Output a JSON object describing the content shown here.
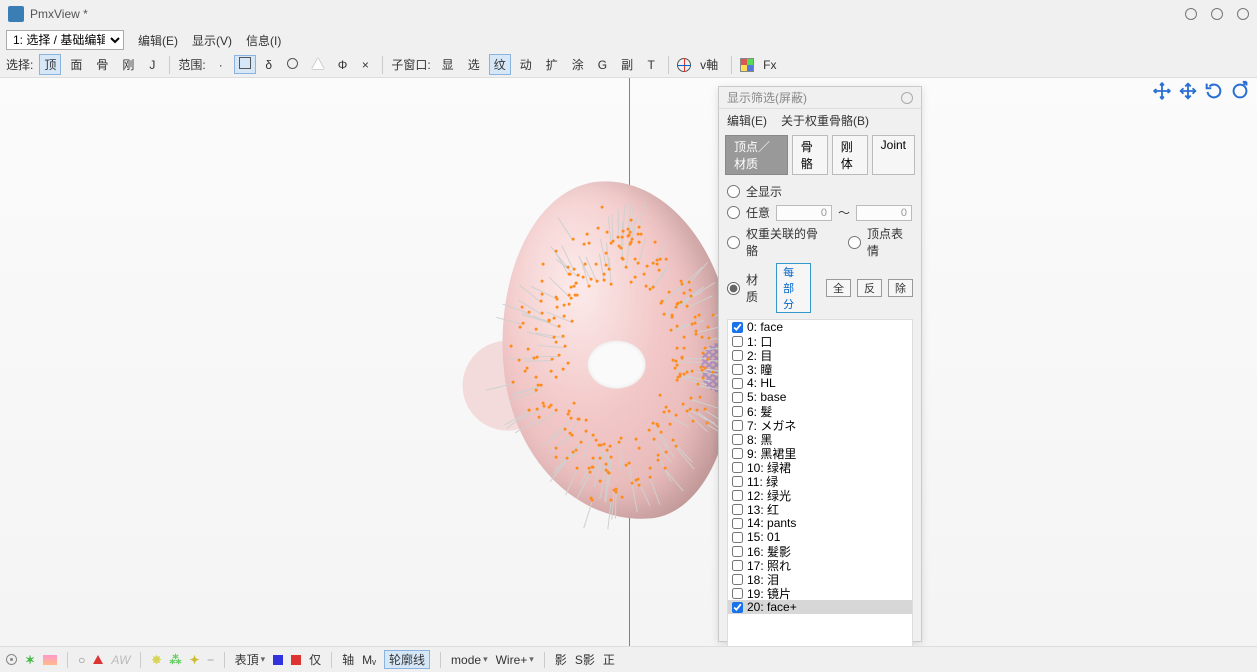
{
  "window": {
    "title": "PmxView *"
  },
  "menubar": {
    "mode_dropdown": "1: 选择 / 基础编辑",
    "edit": "编辑(E)",
    "view": "显示(V)",
    "info": "信息(I)"
  },
  "toolbar": {
    "select_lbl": "选择:",
    "vert": "顶",
    "face": "面",
    "bone": "骨",
    "rigid": "刚",
    "J": "J",
    "range_lbl": "范围:",
    "delta": "δ",
    "phi": "Φ",
    "times": "×",
    "subwindow_lbl": "子窗口:",
    "show": "显",
    "sel": "选",
    "wire": "纹",
    "move": "动",
    "exp": "扩",
    "paint": "涂",
    "G": "G",
    "sub": "副",
    "T": "T",
    "vaxis": "v軸",
    "Fx": "Fx"
  },
  "panel": {
    "title": "显示筛选(屏蔽)",
    "menu": {
      "edit": "编辑(E)",
      "about": "关于权重骨骼(B)"
    },
    "tabs": {
      "vert_mat": "顶点／材质",
      "bone": "骨骼",
      "rigid": "刚体",
      "joint": "Joint"
    },
    "radios": {
      "all": "全显示",
      "any": "任意",
      "any_min": "0",
      "tilde": "～",
      "any_max": "0",
      "weight_bone": "权重关联的骨骼",
      "vert_morph": "顶点表情",
      "material": "材质"
    },
    "buttons": {
      "each": "每部分",
      "all": "全",
      "inv": "反",
      "del": "除"
    },
    "materials": [
      {
        "i": 0,
        "name": "face",
        "checked": true,
        "sel": false
      },
      {
        "i": 1,
        "name": "口",
        "checked": false,
        "sel": false
      },
      {
        "i": 2,
        "name": "目",
        "checked": false,
        "sel": false
      },
      {
        "i": 3,
        "name": "瞳",
        "checked": false,
        "sel": false
      },
      {
        "i": 4,
        "name": "HL",
        "checked": false,
        "sel": false
      },
      {
        "i": 5,
        "name": "base",
        "checked": false,
        "sel": false
      },
      {
        "i": 6,
        "name": "髮",
        "checked": false,
        "sel": false
      },
      {
        "i": 7,
        "name": "メガネ",
        "checked": false,
        "sel": false
      },
      {
        "i": 8,
        "name": "黑",
        "checked": false,
        "sel": false
      },
      {
        "i": 9,
        "name": "黑裙里",
        "checked": false,
        "sel": false
      },
      {
        "i": 10,
        "name": "绿裙",
        "checked": false,
        "sel": false
      },
      {
        "i": 11,
        "name": "绿",
        "checked": false,
        "sel": false
      },
      {
        "i": 12,
        "name": "绿光",
        "checked": false,
        "sel": false
      },
      {
        "i": 13,
        "name": "红",
        "checked": false,
        "sel": false
      },
      {
        "i": 14,
        "name": "pants",
        "checked": false,
        "sel": false
      },
      {
        "i": 15,
        "name": "01",
        "checked": false,
        "sel": false
      },
      {
        "i": 16,
        "name": "髮影",
        "checked": false,
        "sel": false
      },
      {
        "i": 17,
        "name": "照れ",
        "checked": false,
        "sel": false
      },
      {
        "i": 18,
        "name": "泪",
        "checked": false,
        "sel": false
      },
      {
        "i": 19,
        "name": "镜片",
        "checked": false,
        "sel": false
      },
      {
        "i": 20,
        "name": "face+",
        "checked": true,
        "sel": true
      }
    ]
  },
  "statusbar": {
    "morph": "表頂",
    "only": "仅",
    "axis": "轴",
    "m": "Mᵥ",
    "outline": "轮廓线",
    "mode": "mode",
    "wire": "Wire+",
    "shadow": "影",
    "sshadow": "S影",
    "ortho": "正"
  }
}
